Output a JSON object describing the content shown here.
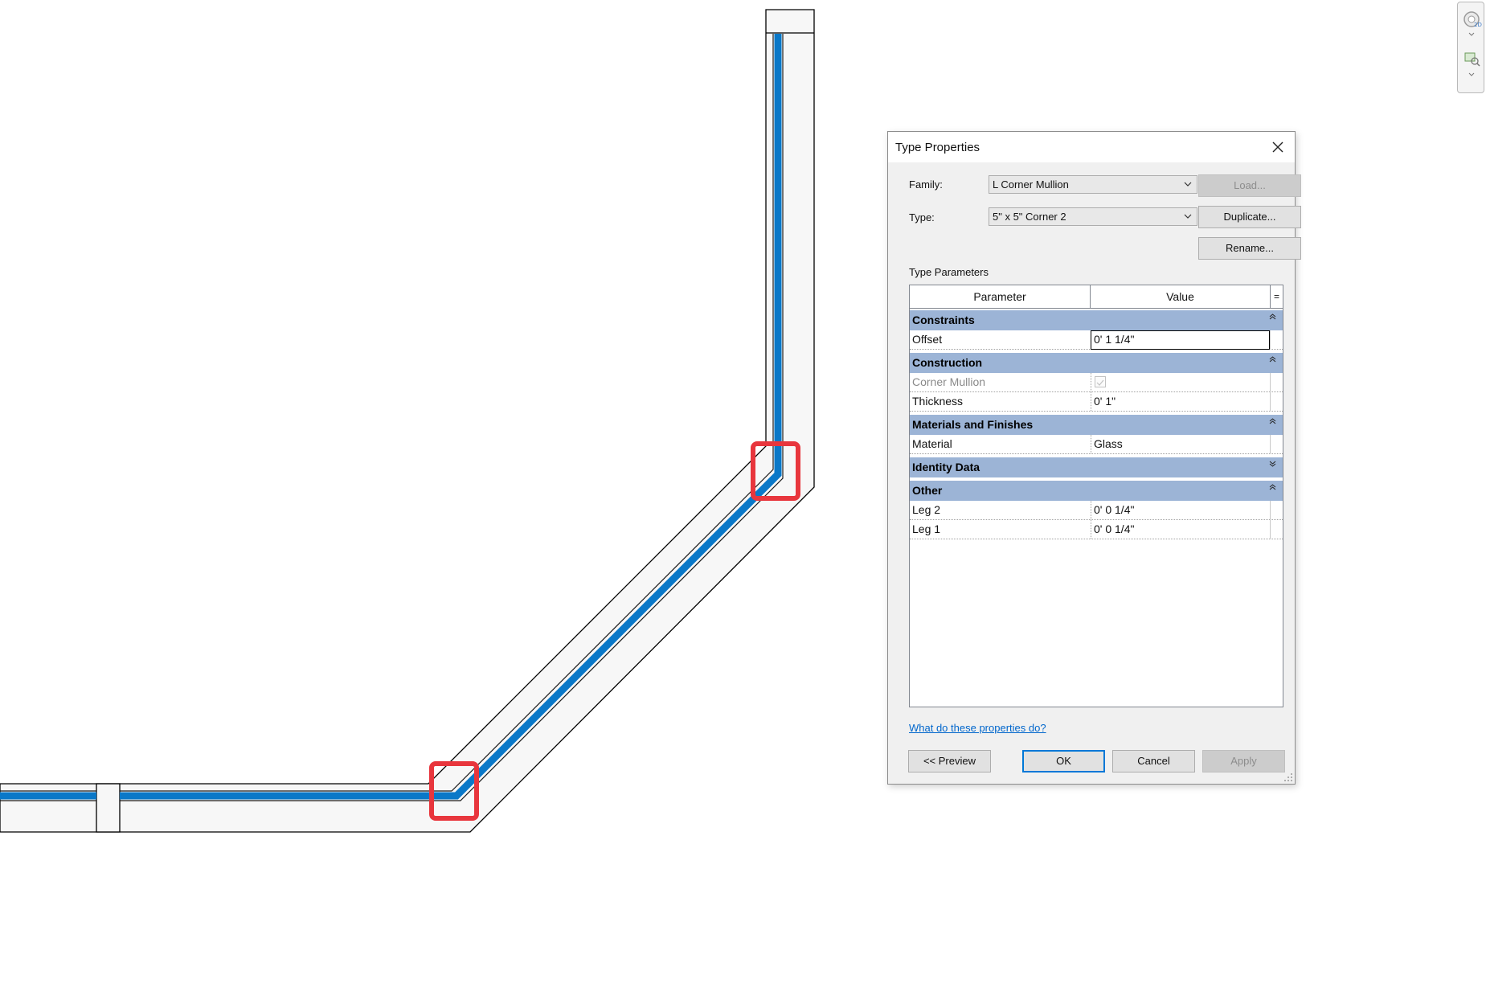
{
  "dialog": {
    "title": "Type Properties",
    "family_label": "Family:",
    "family_value": "L Corner Mullion",
    "type_label": "Type:",
    "type_value": "5\" x 5\" Corner 2",
    "buttons": {
      "load": "Load...",
      "duplicate": "Duplicate...",
      "rename": "Rename...",
      "preview": "<< Preview",
      "ok": "OK",
      "cancel": "Cancel",
      "apply": "Apply"
    },
    "type_parameters_label": "Type Parameters",
    "columns": {
      "parameter": "Parameter",
      "value": "Value",
      "extra": "="
    },
    "groups": {
      "constraints": "Constraints",
      "construction": "Construction",
      "materials": "Materials and Finishes",
      "identity": "Identity Data",
      "other": "Other"
    },
    "params": {
      "offset": {
        "name": "Offset",
        "value": "0'  1 1/4\""
      },
      "corner_mullion": {
        "name": "Corner Mullion",
        "value": ""
      },
      "thickness": {
        "name": "Thickness",
        "value": "0'  1\""
      },
      "material": {
        "name": "Material",
        "value": "Glass"
      },
      "leg2": {
        "name": "Leg 2",
        "value": "0'  0 1/4\""
      },
      "leg1": {
        "name": "Leg 1",
        "value": "0'  0 1/4\""
      }
    },
    "help_link": "What do these properties do?"
  },
  "colors": {
    "mullion_blue": "#0a78c8",
    "highlight_red": "#e8363d",
    "group_header": "#9cb4d6",
    "link_blue": "#0066cc",
    "default_button_border": "#0078d7"
  },
  "icons": [
    "close-icon",
    "chevron-down-icon",
    "collapse-up-icon",
    "expand-down-icon",
    "steering-wheel-icon",
    "zoom-icon",
    "resize-grip-icon"
  ]
}
